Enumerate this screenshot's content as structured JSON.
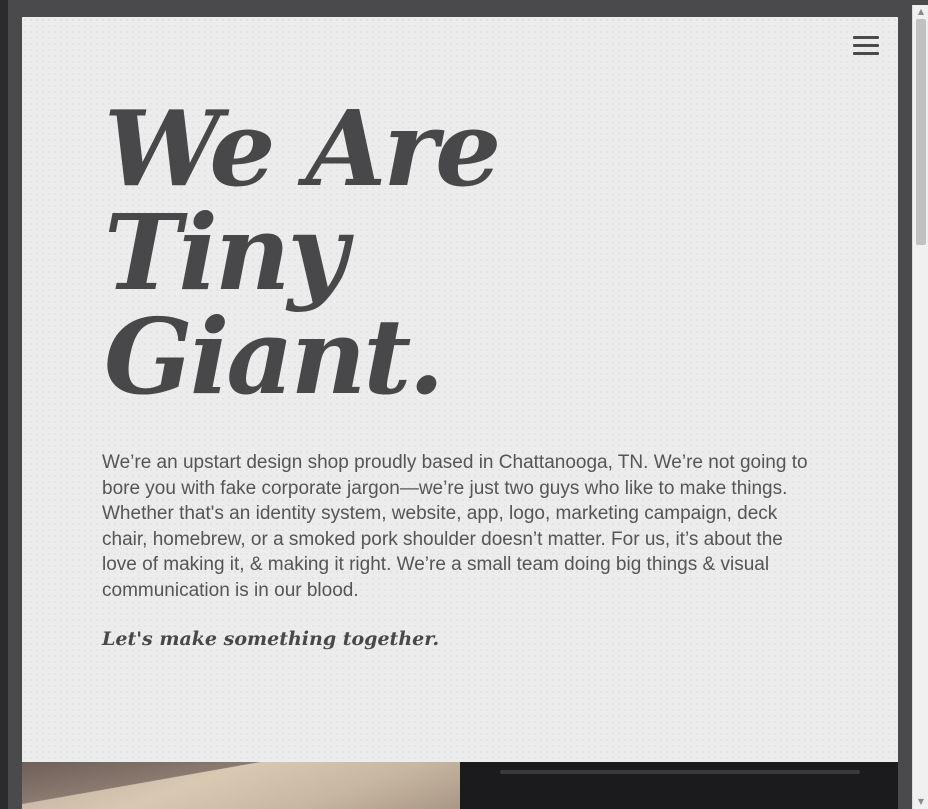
{
  "header": {
    "menu_icon": "hamburger-menu-icon"
  },
  "hero": {
    "title_lines": [
      "We Are",
      "Tiny",
      "Giant."
    ],
    "intro": "We’re an upstart design shop proudly based in Chattanooga, TN. We’re not going to bore you with fake corporate jargon—we’re just two guys who like to make things. Whether that's an identity system, website, app, logo, marketing campaign, deck chair, homebrew, or a smoked pork shoulder doesn’t matter. For us, it’s about the love of making it, & making it right. We’re a small team doing big things & visual communication is in our blood.",
    "cta": "Let's make something together."
  },
  "scrollbar": {
    "up_arrow": "▲",
    "down_arrow": "▼"
  },
  "colors": {
    "background": "#ececec",
    "text_dark": "#48474a",
    "text_body": "#555457",
    "frame": "#4a494c"
  }
}
